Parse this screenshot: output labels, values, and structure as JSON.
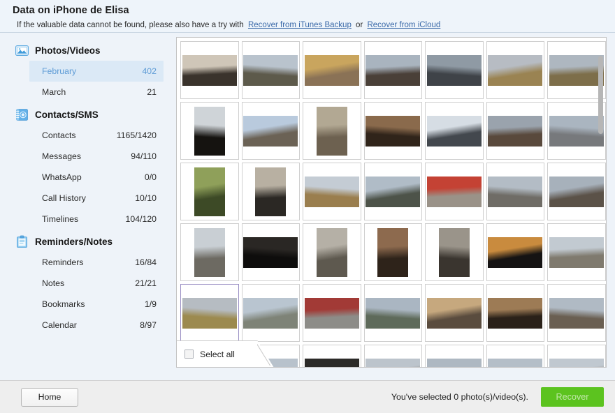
{
  "header": {
    "title": "Data on iPhone de Elisa",
    "subtitle_prefix": "If the valuable data cannot be found, please also have a try with",
    "link_itunes": "Recover from iTunes Backup",
    "or": "or",
    "link_icloud": "Recover from iCloud"
  },
  "sidebar": {
    "groups": [
      {
        "icon": "photo-icon",
        "title": "Photos/Videos",
        "items": [
          {
            "label": "February",
            "count": "402",
            "active": true
          },
          {
            "label": "March",
            "count": "21",
            "active": false
          }
        ]
      },
      {
        "icon": "contacts-book-icon",
        "title": "Contacts/SMS",
        "items": [
          {
            "label": "Contacts",
            "count": "1165/1420",
            "active": false
          },
          {
            "label": "Messages",
            "count": "94/110",
            "active": false
          },
          {
            "label": "WhatsApp",
            "count": "0/0",
            "active": false
          },
          {
            "label": "Call History",
            "count": "10/10",
            "active": false
          },
          {
            "label": "Timelines",
            "count": "104/120",
            "active": false
          }
        ]
      },
      {
        "icon": "clipboard-icon",
        "title": "Reminders/Notes",
        "items": [
          {
            "label": "Reminders",
            "count": "16/84",
            "active": false
          },
          {
            "label": "Notes",
            "count": "21/21",
            "active": false
          },
          {
            "label": "Bookmarks",
            "count": "1/9",
            "active": false
          },
          {
            "label": "Calendar",
            "count": "8/97",
            "active": false
          }
        ]
      }
    ]
  },
  "grid": {
    "thumbs": [
      {
        "orient": "land",
        "c1": "#cfc6b8",
        "c2": "#3a332c",
        "focused": false
      },
      {
        "orient": "land",
        "c1": "#b9c3cd",
        "c2": "#5d5a4b",
        "focused": false
      },
      {
        "orient": "land",
        "c1": "#c9a55e",
        "c2": "#8a7256",
        "focused": false
      },
      {
        "orient": "land",
        "c1": "#a9b4bf",
        "c2": "#4a4038",
        "focused": false
      },
      {
        "orient": "land",
        "c1": "#8f9aa4",
        "c2": "#3f4348",
        "focused": false
      },
      {
        "orient": "land",
        "c1": "#b7bcc3",
        "c2": "#9a8352",
        "focused": false
      },
      {
        "orient": "land",
        "c1": "#aeb7c0",
        "c2": "#7d6e4a",
        "focused": false
      },
      {
        "orient": "port",
        "c1": "#cfd4d8",
        "c2": "#151310",
        "focused": false
      },
      {
        "orient": "land",
        "c1": "#b9cadd",
        "c2": "#6b6255",
        "focused": false
      },
      {
        "orient": "port",
        "c1": "#b2a893",
        "c2": "#6d6150",
        "focused": false
      },
      {
        "orient": "land",
        "c1": "#8a6a4c",
        "c2": "#30241a",
        "focused": false
      },
      {
        "orient": "land",
        "c1": "#d6dde4",
        "c2": "#43484e",
        "focused": false
      },
      {
        "orient": "land",
        "c1": "#9aa3ad",
        "c2": "#59493c",
        "focused": false
      },
      {
        "orient": "land",
        "c1": "#aab5c0",
        "c2": "#77797c",
        "focused": false
      },
      {
        "orient": "port",
        "c1": "#8fa05a",
        "c2": "#3d4a26",
        "focused": false
      },
      {
        "orient": "port",
        "c1": "#b8b0a2",
        "c2": "#2b2824",
        "focused": false
      },
      {
        "orient": "land",
        "c1": "#c4ccd4",
        "c2": "#9a7e4e",
        "focused": false
      },
      {
        "orient": "land",
        "c1": "#b0bcc7",
        "c2": "#4d5349",
        "focused": false
      },
      {
        "orient": "land",
        "c1": "#c44234",
        "c2": "#9a9288",
        "focused": false
      },
      {
        "orient": "land",
        "c1": "#b3bcc5",
        "c2": "#6f6c66",
        "focused": false
      },
      {
        "orient": "land",
        "c1": "#a7b1bb",
        "c2": "#5b5248",
        "focused": false
      },
      {
        "orient": "port",
        "c1": "#c9cfd4",
        "c2": "#6d6a62",
        "focused": false
      },
      {
        "orient": "land",
        "c1": "#2a2724",
        "c2": "#0e0d0c",
        "focused": false
      },
      {
        "orient": "port",
        "c1": "#b5b0a6",
        "c2": "#5e594f",
        "focused": false
      },
      {
        "orient": "port",
        "c1": "#8d6a4e",
        "c2": "#2e231a",
        "focused": false
      },
      {
        "orient": "port",
        "c1": "#9a948a",
        "c2": "#3a352f",
        "focused": false
      },
      {
        "orient": "land",
        "c1": "#c98b3e",
        "c2": "#151313",
        "focused": false
      },
      {
        "orient": "land",
        "c1": "#c2cad1",
        "c2": "#7f7a6e",
        "focused": false
      },
      {
        "orient": "land",
        "c1": "#b6bcc2",
        "c2": "#9c8a4f",
        "focused": true
      },
      {
        "orient": "land",
        "c1": "#b9c5d0",
        "c2": "#7e8377",
        "focused": false
      },
      {
        "orient": "land",
        "c1": "#a23a36",
        "c2": "#8d8c88",
        "focused": false
      },
      {
        "orient": "land",
        "c1": "#aab6c2",
        "c2": "#5e6a5a",
        "focused": false
      },
      {
        "orient": "land",
        "c1": "#c6a87e",
        "c2": "#5a4c3e",
        "focused": false
      },
      {
        "orient": "land",
        "c1": "#9d7b55",
        "c2": "#2a2119",
        "focused": false
      },
      {
        "orient": "land",
        "c1": "#b0bac4",
        "c2": "#6a5f52",
        "focused": false
      },
      {
        "orient": "land",
        "c1": "#c3cad2",
        "c2": "#7a756c",
        "focused": false
      },
      {
        "orient": "land",
        "c1": "#b8c2cc",
        "c2": "#6e6a60",
        "focused": false
      },
      {
        "orient": "land",
        "c1": "#2b2a28",
        "c2": "#111010",
        "focused": false
      },
      {
        "orient": "land",
        "c1": "#bcc4cc",
        "c2": "#756f66",
        "focused": false
      },
      {
        "orient": "land",
        "c1": "#aeb8c2",
        "c2": "#625b50",
        "focused": false
      },
      {
        "orient": "land",
        "c1": "#b4bec8",
        "c2": "#6b6458",
        "focused": false
      },
      {
        "orient": "land",
        "c1": "#c0c8d0",
        "c2": "#7c766c",
        "focused": false
      }
    ]
  },
  "select_all": {
    "label": "Select all",
    "checked": false
  },
  "footer": {
    "home_label": "Home",
    "status": "You've selected 0 photo(s)/video(s).",
    "recover_label": "Recover",
    "recover_color": "#5cc31f"
  }
}
